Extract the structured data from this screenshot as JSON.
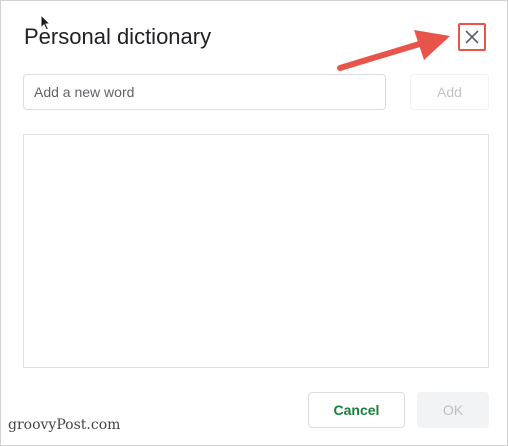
{
  "dialog": {
    "title": "Personal dictionary",
    "close_icon": "close-icon"
  },
  "add_word": {
    "placeholder": "Add a new word",
    "value": "",
    "add_label": "Add"
  },
  "word_list": {
    "items": []
  },
  "footer": {
    "cancel_label": "Cancel",
    "ok_label": "OK"
  },
  "watermark": "groovyPost.com",
  "annotation": {
    "arrow_color": "#e8534a",
    "highlight_color": "#e8534a"
  },
  "colors": {
    "accent": "#188038",
    "title_text": "#202124"
  }
}
